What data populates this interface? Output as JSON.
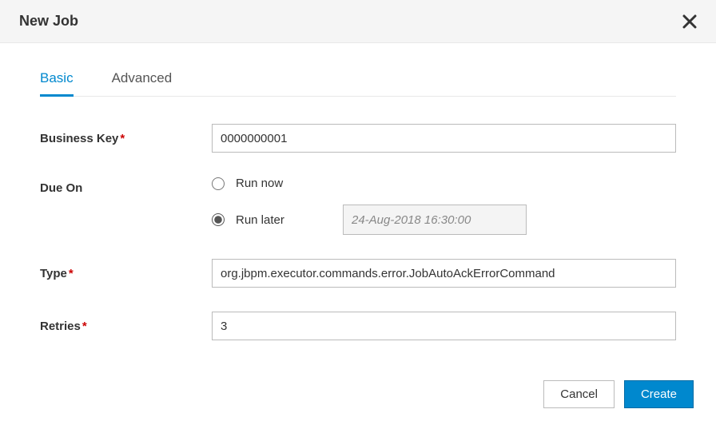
{
  "header": {
    "title": "New Job"
  },
  "tabs": {
    "basic": "Basic",
    "advanced": "Advanced"
  },
  "form": {
    "business_key": {
      "label": "Business Key",
      "value": "0000000001"
    },
    "due_on": {
      "label": "Due On",
      "run_now": "Run now",
      "run_later": "Run later",
      "date_value": "24-Aug-2018 16:30:00"
    },
    "type": {
      "label": "Type",
      "value": "org.jbpm.executor.commands.error.JobAutoAckErrorCommand"
    },
    "retries": {
      "label": "Retries",
      "value": "3"
    }
  },
  "footer": {
    "cancel": "Cancel",
    "create": "Create"
  }
}
